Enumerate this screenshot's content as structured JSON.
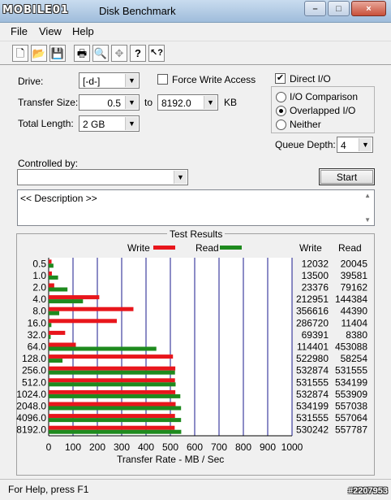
{
  "window": {
    "logo_text": "MOBILE01",
    "title": "Disk Benchmark",
    "minimize": "–",
    "maximize": "□",
    "close": "×"
  },
  "menu": [
    "File",
    "View",
    "Help"
  ],
  "toolbar": [
    {
      "name": "new-icon",
      "glyph": "🗋"
    },
    {
      "name": "open-icon",
      "glyph": "📂"
    },
    {
      "name": "save-icon",
      "glyph": "💾"
    },
    {
      "name": "print-icon",
      "glyph": "🖶"
    },
    {
      "name": "print-preview-icon",
      "glyph": "🔍"
    },
    {
      "name": "move-icon",
      "glyph": "✥"
    },
    {
      "name": "help-icon",
      "glyph": "?"
    },
    {
      "name": "context-help-icon",
      "glyph": "↖?"
    }
  ],
  "form": {
    "drive_label": "Drive:",
    "drive_value": "[-d-]",
    "transfer_label": "Transfer Size:",
    "transfer_from": "0.5",
    "to_label": "to",
    "transfer_to": "8192.0",
    "kb_label": "KB",
    "total_label": "Total Length:",
    "total_value": "2 GB",
    "force_write_label": "Force Write Access",
    "force_write_checked": false,
    "direct_io_label": "Direct I/O",
    "direct_io_checked": true,
    "io_comparison": "I/O Comparison",
    "overlapped_io": "Overlapped I/O",
    "neither": "Neither",
    "selected_mode": "overlapped",
    "queue_label": "Queue Depth:",
    "queue_value": "4",
    "controlled_label": "Controlled by:",
    "controlled_value": "",
    "start_label": "Start",
    "description": "<< Description >>"
  },
  "results": {
    "title": "Test Results",
    "legend_write": "Write",
    "legend_read": "Read",
    "col_write": "Write",
    "col_read": "Read",
    "write_color": "#e8161c",
    "read_color": "#1e8a1e"
  },
  "chart_data": {
    "type": "bar",
    "orientation": "horizontal",
    "categories": [
      "0.5",
      "1.0",
      "2.0",
      "4.0",
      "8.0",
      "16.0",
      "32.0",
      "64.0",
      "128.0",
      "256.0",
      "512.0",
      "1024.0",
      "2048.0",
      "4096.0",
      "8192.0"
    ],
    "series": [
      {
        "name": "Write",
        "values": [
          12032,
          13500,
          23376,
          212951,
          356616,
          286720,
          69391,
          114401,
          522980,
          532874,
          531555,
          532874,
          534199,
          531555,
          530242
        ]
      },
      {
        "name": "Read",
        "values": [
          20045,
          39581,
          79162,
          144384,
          44390,
          11404,
          8380,
          453088,
          58254,
          531555,
          534199,
          553909,
          557038,
          557064,
          557787
        ]
      }
    ],
    "xlabel": "Transfer Rate - MB / Sec",
    "xlim": [
      0,
      1000
    ],
    "xticks": [
      0,
      100,
      200,
      300,
      400,
      500,
      600,
      700,
      800,
      900,
      1000
    ]
  },
  "status": {
    "text": "For Help, press F1",
    "watermark": "#2207953"
  }
}
